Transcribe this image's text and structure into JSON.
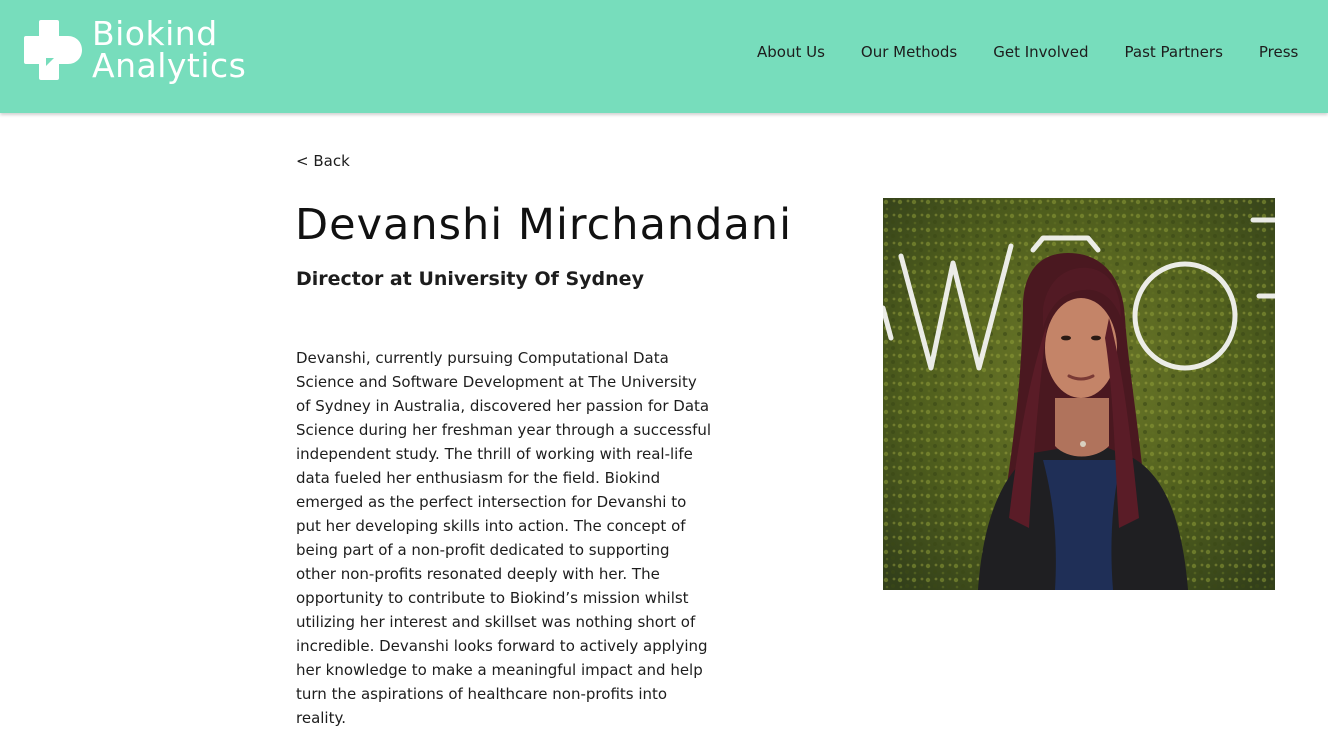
{
  "brand": {
    "line1": "Biokind",
    "line2": "Analytics"
  },
  "nav": {
    "items": [
      {
        "label": "About Us"
      },
      {
        "label": "Our Methods"
      },
      {
        "label": "Get Involved"
      },
      {
        "label": "Past Partners"
      },
      {
        "label": "Press"
      }
    ]
  },
  "page": {
    "back_label": "< Back",
    "name": "Devanshi Mirchandani",
    "role": "Director at University Of Sydney",
    "bio": "Devanshi, currently pursuing Computational Data Science and Software Development at The University of Sydney in Australia, discovered her passion for Data Science during her freshman year through a successful independent study. The thrill of working with real-life data fueled her enthusiasm for the field. Biokind emerged as the perfect intersection for Devanshi to put her developing skills into action. The concept of being part of a non-profit dedicated to supporting other non-profits resonated deeply with her. The opportunity to contribute to Biokind’s mission whilst utilizing her interest and skillset was nothing short of incredible. Devanshi looks forward to actively applying her knowledge to make a meaningful impact and help turn the aspirations of healthcare non-profits into reality."
  },
  "colors": {
    "header_bg": "#77ddbc",
    "logo": "#ffffff",
    "text": "#1d1d1d"
  },
  "icons": {
    "logo": "cross-bubble-logo-icon"
  }
}
